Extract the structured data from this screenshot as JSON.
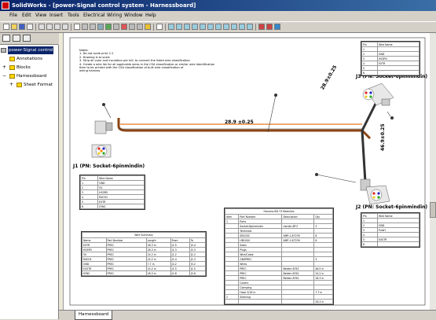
{
  "window": {
    "title": "SolidWorks - [power-Signal control system - Harnessboard]"
  },
  "menu": [
    "File",
    "Edit",
    "View",
    "Insert",
    "Tools",
    "Electrical",
    "Wiring",
    "Window",
    "Help"
  ],
  "tree": [
    {
      "label": "power-Signal control",
      "icon": "assembly-icon",
      "selected": true
    },
    {
      "label": "Annotations",
      "icon": "annotations-icon"
    },
    {
      "label": "Blocks",
      "icon": "blocks-icon"
    },
    {
      "label": "Harnessboard",
      "icon": "sheet-icon"
    },
    {
      "label": "Sheet Format",
      "icon": "sheet-format-icon"
    }
  ],
  "drawing": {
    "notes": [
      "Notes:",
      "1. Do not scale print 1:1",
      "2. Drawing is to scale",
      "3. Strip all color and insulation per bill, to connect the listed wire classification",
      "4. Create a wire list for all applicable wires in the CSA classification or similar wire identification",
      "   Item to be printed with the CSA classification of bulk wire classification of",
      "   wiring harness"
    ],
    "dim_main": "28.9 ±0.25",
    "dim_upper": "28.9±0.25",
    "dim_right": "46.9±0.25",
    "connectors": [
      {
        "id": "J1",
        "label": "J1 (PN: Socket-6pinmindin)"
      },
      {
        "id": "J2",
        "label": "J2 (PN: Socket-6pinmindin)"
      },
      {
        "id": "J3",
        "label": "J3 (PN: Socket-6pinmindin)"
      }
    ],
    "pin_table_j1": {
      "headers": [
        "Pin",
        "Wire Name"
      ],
      "rows": [
        [
          "1",
          "GND"
        ],
        [
          "2",
          "5V"
        ],
        [
          "3",
          "HS3PD"
        ],
        [
          "4",
          "RXCH1"
        ],
        [
          "5",
          "EXTR"
        ],
        [
          "6",
          "SYNC"
        ]
      ]
    },
    "pin_table_j2": {
      "headers": [
        "Pin",
        "Wire Name"
      ],
      "rows": [
        [
          "1",
          ""
        ],
        [
          "2",
          "GND"
        ],
        [
          "3",
          "PulsH"
        ],
        [
          "4",
          ""
        ],
        [
          "5",
          "EXSTR"
        ],
        [
          "6",
          ""
        ]
      ]
    },
    "pin_table_j3": {
      "headers": [
        "Pin",
        "Wire Name"
      ],
      "rows": [
        [
          "1",
          ""
        ],
        [
          "2",
          "GND"
        ],
        [
          "3",
          "HS3PD"
        ],
        [
          "4",
          "EXTR"
        ],
        [
          "5",
          ""
        ],
        [
          "6",
          ""
        ]
      ]
    },
    "wire_summary": {
      "caption": "Wire Summary",
      "headers": [
        "Name",
        "Part Number",
        "Length",
        "From",
        "To"
      ],
      "rows": [
        [
          "EXTR",
          "PREC",
          "28.3 in",
          "J1-5",
          "J3-4"
        ],
        [
          "HS3PD",
          "PREC",
          "28.3 in",
          "J1-3",
          "J3-3"
        ],
        [
          "5V",
          "PREC",
          "24.2 in",
          "J1-2",
          "J2-2"
        ],
        [
          "RXCH1",
          "PREC",
          "24.2 in",
          "J1-4",
          "J2-3"
        ],
        [
          "GND",
          "PREC",
          "7.7 in",
          "J2-2",
          "J3-2"
        ],
        [
          "EXSTR",
          "PREC",
          "24.2 in",
          "J1-5",
          "J2-5"
        ],
        [
          "SYNC",
          "PREC",
          "28.3 in",
          "J1-6",
          "J3-6"
        ]
      ]
    },
    "bom": {
      "caption": "Harness Bill Of Materials",
      "headers": [
        "Item",
        "Part Number",
        "Description",
        "Qty"
      ],
      "rows": [
        [
          "1",
          "Parts",
          "",
          ""
        ],
        [
          "",
          "Socket-6pinmindin",
          "mindin-6P-F",
          "3"
        ],
        [
          "",
          "Terminals",
          "",
          ""
        ],
        [
          "",
          "SB1000",
          "AMP-1-87239",
          "6"
        ],
        [
          "",
          "HB1000",
          "AMP-1-87239",
          "6"
        ],
        [
          "",
          "Seals",
          "",
          ""
        ],
        [
          "",
          "Plugs",
          "",
          ""
        ],
        [
          "",
          "Wire/Cable",
          "",
          ""
        ],
        [
          "",
          "GBXPREC",
          "",
          "3"
        ],
        [
          "",
          "Wires",
          "",
          ""
        ],
        [
          "",
          "PREC",
          "Belden 8761",
          "48.5 in"
        ],
        [
          "",
          "PREC",
          "Belden 8761",
          "24.2 in"
        ],
        [
          "",
          "PREC",
          "Belden 8761",
          "28.3 in"
        ],
        [
          "",
          "Covers",
          "",
          ""
        ],
        [
          "",
          "Clamping",
          "",
          ""
        ],
        [
          "",
          "Hose 3/16 in",
          "",
          "7.7 in"
        ],
        [
          "2",
          "Sleeving",
          "",
          ""
        ],
        [
          "",
          "",
          "",
          "28.3 in"
        ]
      ]
    }
  },
  "sheet_tab": "Harnessboard",
  "colors": {
    "title_left": "#0a246a",
    "title_right": "#3a6ea5",
    "wire_brown": "#8b4513",
    "wire_orange": "#e07820"
  }
}
